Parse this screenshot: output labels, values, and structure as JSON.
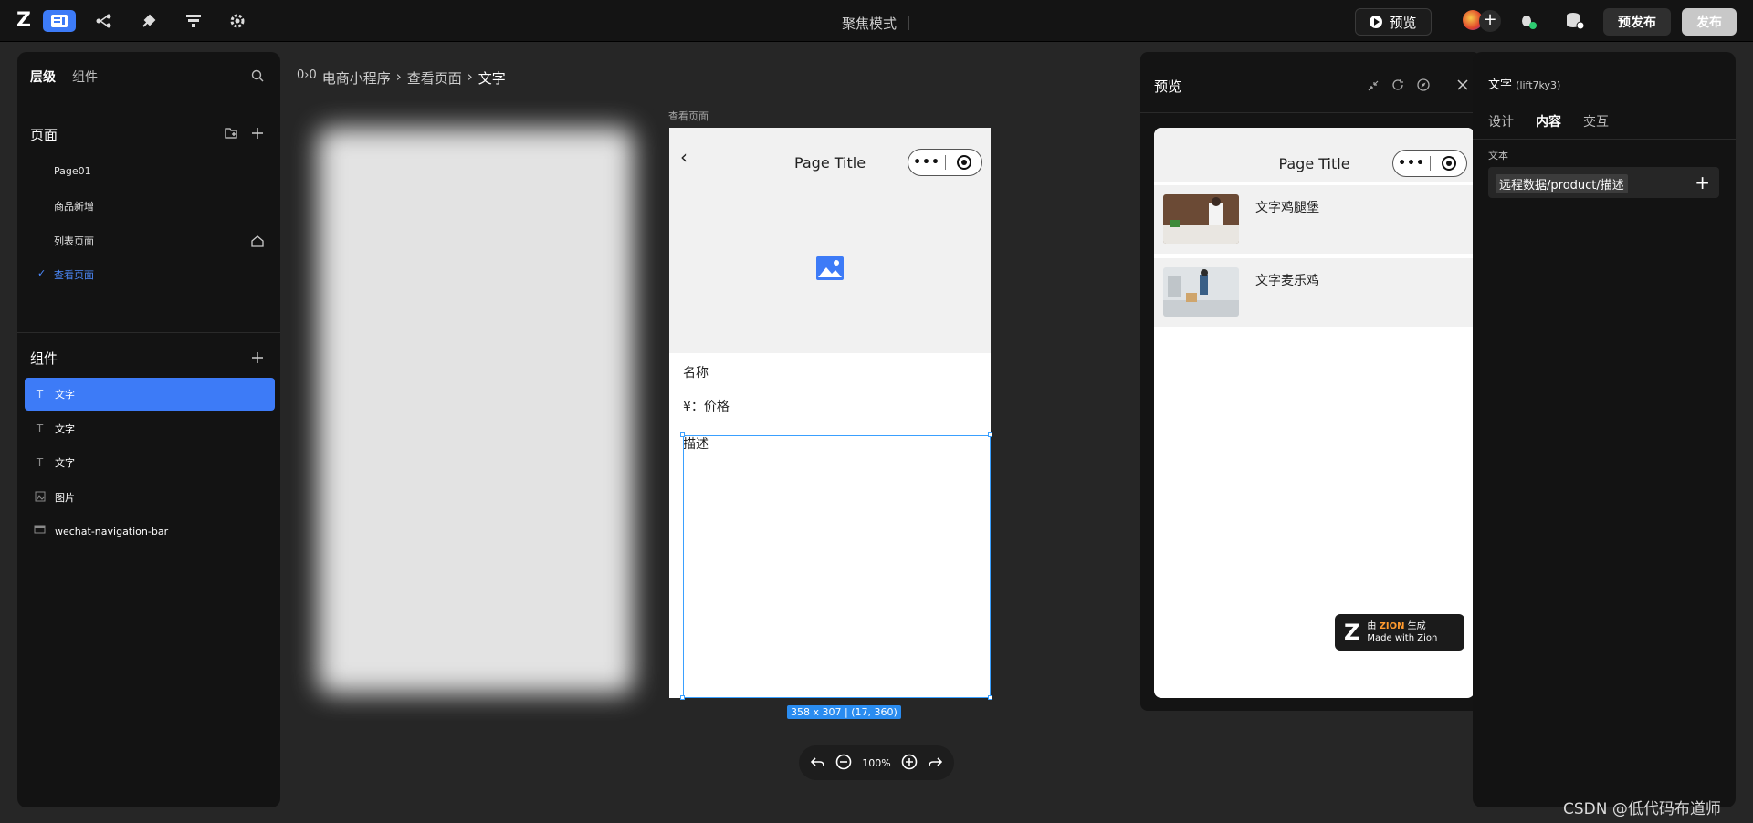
{
  "topbar": {
    "logo": "Z",
    "icons": [
      "pages-icon",
      "logic-flow-icon",
      "plugin-icon",
      "data-icon",
      "settings-icon"
    ],
    "focus_mode": "聚焦模式",
    "preview_label": "预览",
    "prepublish_label": "预发布",
    "publish_label": "发布"
  },
  "left_panel": {
    "tabs": [
      "层级",
      "组件"
    ],
    "pages_title": "页面",
    "pages": [
      "Page01",
      "商品新增",
      "列表页面",
      "查看页面"
    ],
    "components_title": "组件",
    "components": [
      {
        "label": "文字",
        "icon": "text-icon"
      },
      {
        "label": "文字",
        "icon": "text-icon"
      },
      {
        "label": "文字",
        "icon": "text-icon"
      },
      {
        "label": "图片",
        "icon": "image-icon"
      },
      {
        "label": "wechat-navigation-bar",
        "icon": "navbar-icon"
      }
    ]
  },
  "canvas": {
    "breadcrumb": [
      "电商小程序",
      "查看页面",
      "文字"
    ],
    "breadcrumb_sep": "›",
    "page_label": "查看页面",
    "phone": {
      "title": "Page Title",
      "name_text": "名称",
      "price_text": "¥：价格",
      "desc_text": "描述"
    },
    "selection_badge": "358 x 307 | (17, 360)",
    "zoom": "100%"
  },
  "preview": {
    "title": "预览",
    "phone_title": "Page Title",
    "items": [
      "文字鸡腿堡",
      "文字麦乐鸡"
    ],
    "badge_line1_prefix": "由",
    "badge_brand": "ZION",
    "badge_line1_suffix": "生成",
    "badge_line2": "Made with Zion"
  },
  "right_panel": {
    "title": "文字",
    "id": "(lift7ky3)",
    "tabs": [
      "设计",
      "内容",
      "交互"
    ],
    "field_label": "文本",
    "field_value": "远程数据/product/描述"
  },
  "watermark": "CSDN @低代码布道师",
  "colors": {
    "accent": "#3d7bf7",
    "selection": "#3aa0ff",
    "brand_orange": "#ff9a2e"
  }
}
